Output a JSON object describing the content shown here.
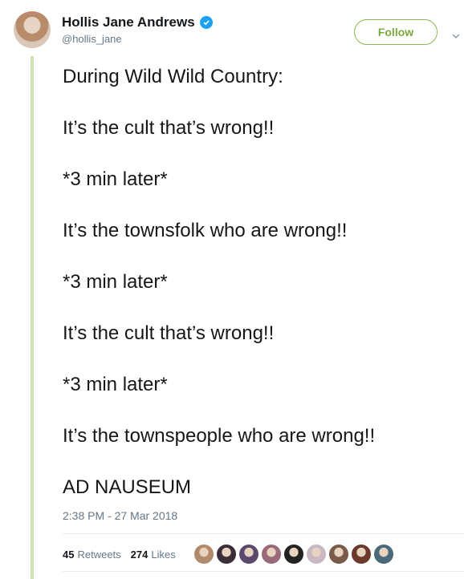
{
  "user": {
    "display_name": "Hollis Jane Andrews",
    "handle": "@hollis_jane",
    "verified_icon": "verified-badge-icon",
    "avatar_icon": "profile-avatar"
  },
  "follow_button": {
    "label": "Follow"
  },
  "menu_icon": "chevron-down-icon",
  "tweet": {
    "lines": [
      "During Wild Wild Country:",
      "It’s the cult that’s wrong!!",
      "*3 min later*",
      "It’s the townsfolk who are wrong!!",
      "*3 min later*",
      "It’s the cult that’s wrong!!",
      "*3 min later*",
      "It’s the townspeople who are wrong!!",
      "AD NAUSEUM"
    ],
    "timestamp": "2:38 PM - 27 Mar 2018"
  },
  "stats": {
    "retweets_count": "45",
    "retweets_label": "Retweets",
    "likes_count": "274",
    "likes_label": "Likes"
  },
  "likers": [
    {
      "color": "#b08a6b"
    },
    {
      "color": "#3a2d3a"
    },
    {
      "color": "#5b4a6e"
    },
    {
      "color": "#9a6a7a"
    },
    {
      "color": "#222222"
    },
    {
      "color": "#c9b7c2"
    },
    {
      "color": "#7a5a48"
    },
    {
      "color": "#6a3a2a"
    },
    {
      "color": "#4a6a7a"
    }
  ],
  "colors": {
    "accent_green": "#7aa83b",
    "thread_line": "#cfe3b0",
    "verified_blue": "#1da1f2",
    "muted_text": "#657786"
  }
}
